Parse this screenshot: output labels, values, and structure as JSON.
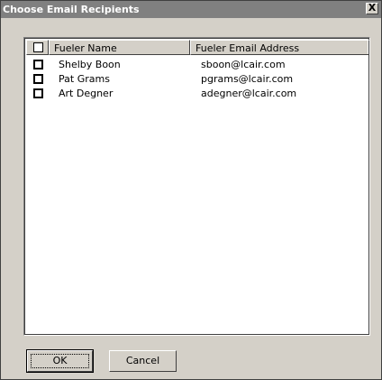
{
  "window": {
    "title": "Choose Email Recipients",
    "close_label": "X"
  },
  "listview": {
    "columns": [
      "Fueler Name",
      "Fueler Email Address"
    ],
    "select_all_checked": false,
    "rows": [
      {
        "name": "Shelby Boon",
        "email": "sboon@lcair.com",
        "checked": false
      },
      {
        "name": "Pat Grams",
        "email": "pgrams@lcair.com",
        "checked": false
      },
      {
        "name": "Art Degner",
        "email": "adegner@lcair.com",
        "checked": false
      }
    ]
  },
  "buttons": {
    "ok_label": "OK",
    "cancel_label": "Cancel"
  },
  "colors": {
    "dialog_face": "#d4d0c8",
    "title_bar": "#808080",
    "list_background": "#ffffff"
  }
}
